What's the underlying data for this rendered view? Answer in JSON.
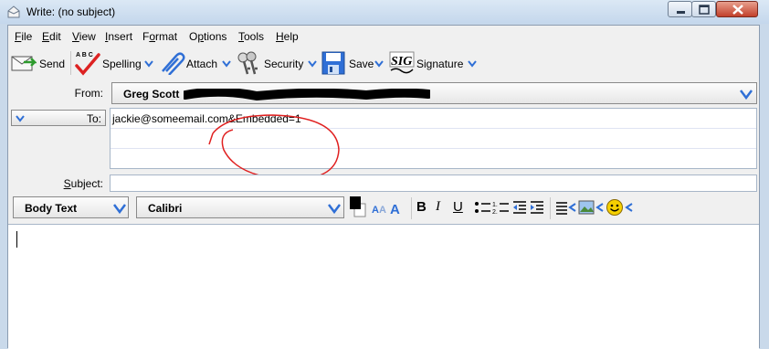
{
  "window": {
    "title": "Write: (no subject)"
  },
  "menu": [
    {
      "label": "File",
      "key": "F",
      "rest": "ile"
    },
    {
      "label": "Edit",
      "key": "E",
      "rest": "dit"
    },
    {
      "label": "View",
      "key": "V",
      "rest": "iew"
    },
    {
      "label": "Insert",
      "key": "I",
      "rest": "nsert"
    },
    {
      "label": "Format",
      "key": "F",
      "rest": "ormat",
      "pre": "",
      "alt_pre": "F"
    },
    {
      "label": "Options",
      "key": "p",
      "pre": "O",
      "rest": "tions"
    },
    {
      "label": "Tools",
      "key": "T",
      "rest": "ools"
    },
    {
      "label": "Help",
      "key": "H",
      "rest": "elp"
    }
  ],
  "toolbar": {
    "send": "Send",
    "spelling": "Spelling",
    "attach": "Attach",
    "security": "Security",
    "save": "Save",
    "signature": "Signature",
    "sig_icon_text": "SIG",
    "abc_text": "A B C"
  },
  "header": {
    "from_label": "From:",
    "from_value": "Greg Scott",
    "to_label": "To:",
    "to_value": "jackie@someemail.com&Embedded=1",
    "subject_label": "Subject:",
    "subject_value": ""
  },
  "format": {
    "paragraph_style": "Body Text",
    "font": "Calibri",
    "bold": "B",
    "italic": "I",
    "underline": "U",
    "text_color": "#000000",
    "bg_color": "#ffffff"
  },
  "colors": {
    "accent_blue": "#2f6fd6",
    "annotation_red": "#e02020",
    "redaction": "#000000"
  }
}
